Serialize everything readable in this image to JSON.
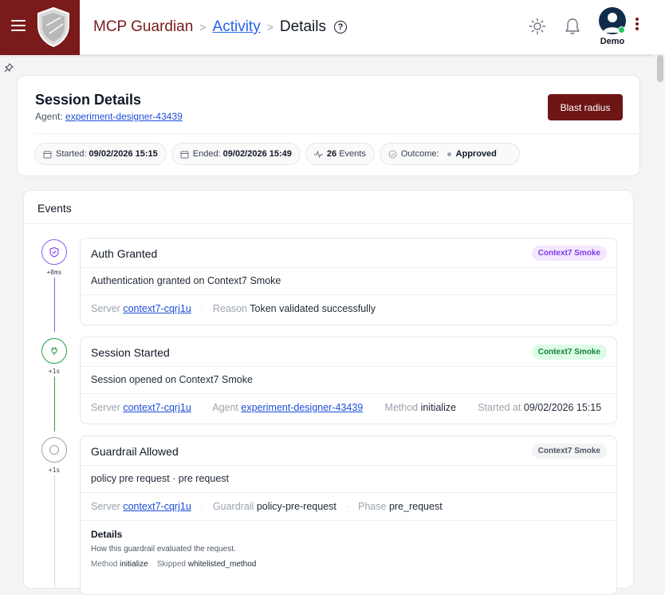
{
  "header": {
    "breadcrumb": {
      "app": "MCP Guardian",
      "sep1": ">",
      "activity": "Activity",
      "sep2": ">",
      "current": "Details"
    },
    "help_glyph": "?",
    "user": {
      "name": "Demo",
      "status_color": "#22c55e"
    },
    "icons": [
      "menu-icon",
      "shield-logo-icon",
      "help-icon",
      "sun-icon",
      "bell-icon",
      "avatar",
      "kebab-menu-icon",
      "pin-icon"
    ],
    "brand_color": "#7a1a1a"
  },
  "session": {
    "title": "Session Details",
    "agent_label": "Agent:",
    "agent_value": "experiment-designer-43439",
    "blast_button": "Blast radius",
    "chips": {
      "started_label": "Started:",
      "started_value": "09/02/2026 15:15",
      "ended_label": "Ended:",
      "ended_value": "09/02/2026 15:49",
      "events_count": "26",
      "events_label": "Events",
      "outcome_label": "Outcome:",
      "outcome_value": "Approved"
    }
  },
  "events": {
    "title": "Events",
    "items": [
      {
        "time": "+0ms",
        "title": "Auth Granted",
        "tag": "Context7 Smoke",
        "description": "Authentication granted on Context7 Smoke",
        "server_label": "Server",
        "server_value": "context7-cqrj1u",
        "reason_label": "Reason",
        "reason_value": "Token validated successfully",
        "color": "#7c3aed",
        "tag_bg": "#f3e8ff"
      },
      {
        "time": "+1s",
        "title": "Session Started",
        "tag": "Context7 Smoke",
        "description": "Session opened on Context7 Smoke",
        "server_label": "Server",
        "server_value": "context7-cqrj1u",
        "agent_label": "Agent",
        "agent_value": "experiment-designer-43439",
        "method_label": "Method",
        "method_value": "initialize",
        "started_label": "Started at",
        "started_value": "09/02/2026 15:15",
        "color": "#22a045",
        "tag_bg": "#dcfce7"
      },
      {
        "time": "+1s",
        "title": "Guardrail Allowed",
        "tag": "Context7 Smoke",
        "description": "policy pre request · pre request",
        "server_label": "Server",
        "server_value": "context7-cqrj1u",
        "guardrail_label": "Guardrail",
        "guardrail_value": "policy-pre-request",
        "phase_label": "Phase",
        "phase_value": "pre_request",
        "details_title": "Details",
        "details_sub": "How this guardrail evaluated the request.",
        "method_label": "Method",
        "method_value": "initialize",
        "skipped_label": "Skipped",
        "skipped_value": "whitelisted_method",
        "color": "#6b7280",
        "tag_bg": "#f3f4f6"
      }
    ]
  }
}
